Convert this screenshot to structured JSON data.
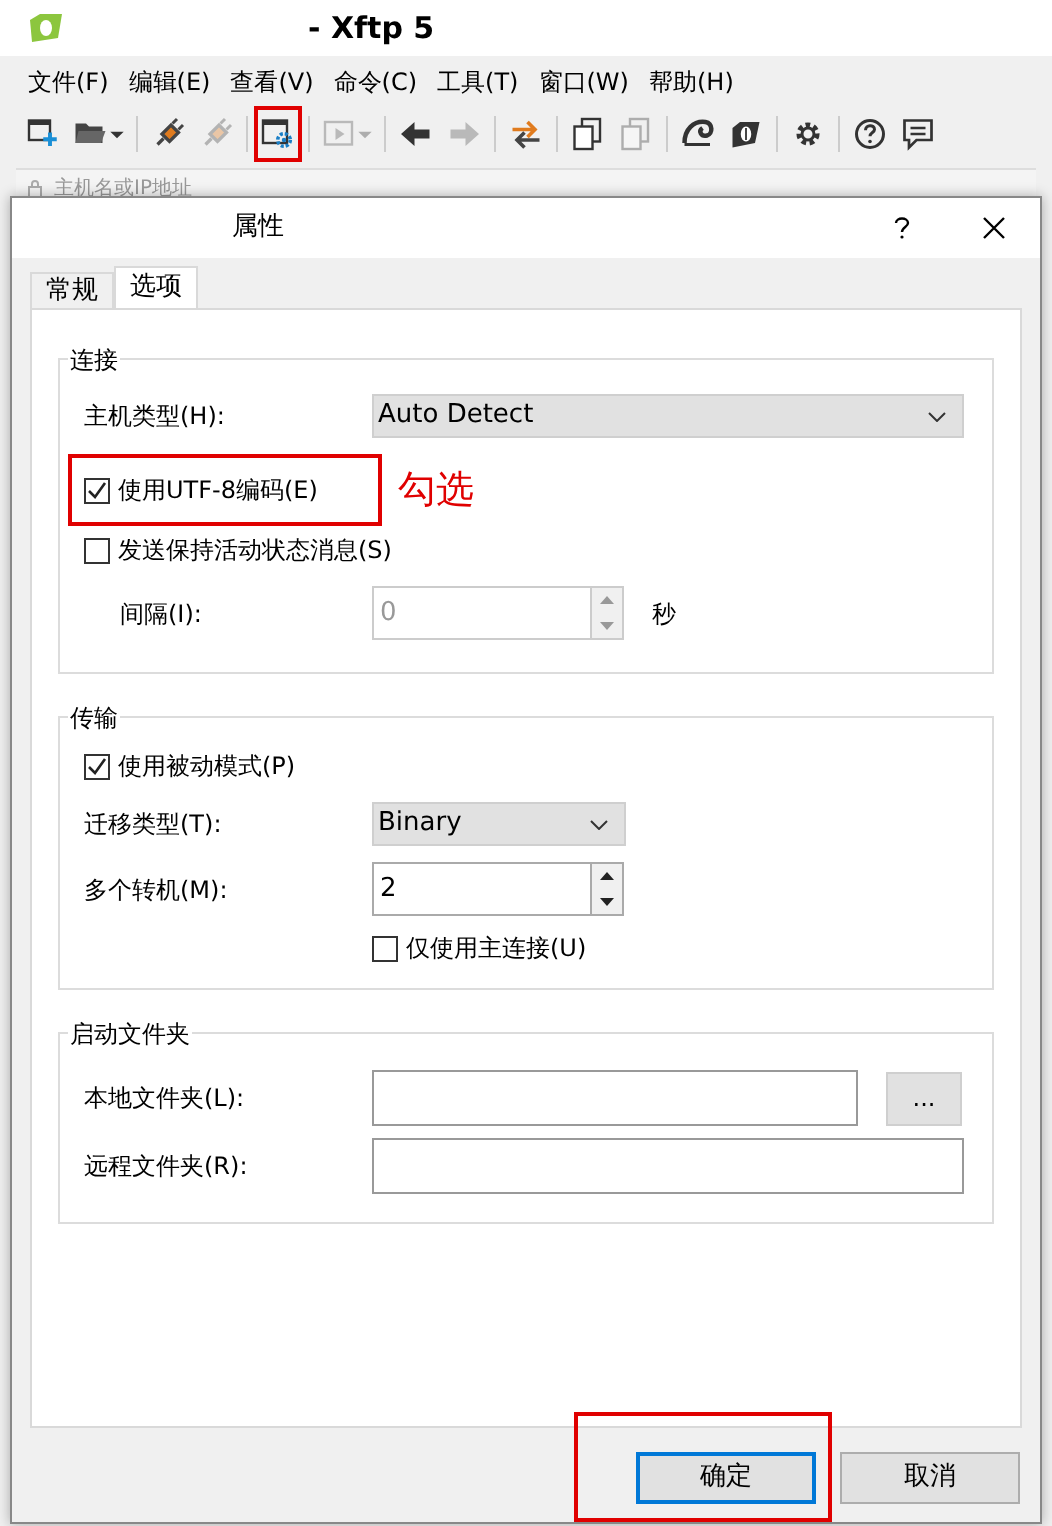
{
  "window": {
    "title": "- Xftp 5"
  },
  "menu": [
    "文件(F)",
    "编辑(E)",
    "查看(V)",
    "命令(C)",
    "工具(T)",
    "窗口(W)",
    "帮助(H)"
  ],
  "toolbar": [
    {
      "kind": "new",
      "disabled": false,
      "highlighted": false,
      "dropdown": false
    },
    {
      "kind": "folder",
      "disabled": false,
      "highlighted": false,
      "dropdown": true
    },
    {
      "kind": "sep"
    },
    {
      "kind": "connect",
      "disabled": false,
      "highlighted": false,
      "dropdown": false
    },
    {
      "kind": "connect",
      "disabled": true,
      "highlighted": false,
      "dropdown": false
    },
    {
      "kind": "sep"
    },
    {
      "kind": "properties",
      "disabled": false,
      "highlighted": true,
      "dropdown": false
    },
    {
      "kind": "sep"
    },
    {
      "kind": "play",
      "disabled": true,
      "highlighted": false,
      "dropdown": true
    },
    {
      "kind": "sep"
    },
    {
      "kind": "back",
      "disabled": false,
      "highlighted": false,
      "dropdown": false
    },
    {
      "kind": "forward",
      "disabled": true,
      "highlighted": false,
      "dropdown": false
    },
    {
      "kind": "sep"
    },
    {
      "kind": "transfer",
      "disabled": false,
      "highlighted": false,
      "dropdown": false
    },
    {
      "kind": "sep"
    },
    {
      "kind": "copy",
      "disabled": false,
      "highlighted": false,
      "dropdown": false
    },
    {
      "kind": "copy",
      "disabled": true,
      "highlighted": false,
      "dropdown": false
    },
    {
      "kind": "sep"
    },
    {
      "kind": "shell",
      "disabled": false,
      "highlighted": false,
      "dropdown": false
    },
    {
      "kind": "leaf",
      "disabled": false,
      "highlighted": false,
      "dropdown": false
    },
    {
      "kind": "sep"
    },
    {
      "kind": "gear",
      "disabled": false,
      "highlighted": false,
      "dropdown": false
    },
    {
      "kind": "sep"
    },
    {
      "kind": "help",
      "disabled": false,
      "highlighted": false,
      "dropdown": false
    },
    {
      "kind": "chat",
      "disabled": false,
      "highlighted": false,
      "dropdown": false
    }
  ],
  "address": {
    "placeholder": "主机名或IP地址"
  },
  "dialog": {
    "title": "属性",
    "tabs": [
      {
        "label": "常规",
        "selected": false
      },
      {
        "label": "选项",
        "selected": true
      }
    ],
    "groups": [
      {
        "title": "连接",
        "rows": [
          {
            "kind": "select",
            "label": "主机类型(H):",
            "value": "Auto Detect",
            "wide": true
          },
          {
            "kind": "checkbox",
            "label": "使用UTF-8编码(E)",
            "checked": true,
            "highlighted": true,
            "note": "勾选"
          },
          {
            "kind": "checkbox",
            "label": "发送保持活动状态消息(S)",
            "checked": false,
            "highlighted": false
          },
          {
            "kind": "spinner",
            "label": "间隔(I):",
            "value": "0",
            "disabled": true,
            "unit": "秒"
          }
        ]
      },
      {
        "title": "传输",
        "rows": [
          {
            "kind": "checkbox",
            "label": "使用被动模式(P)",
            "checked": true,
            "highlighted": false
          },
          {
            "kind": "select",
            "label": "迁移类型(T):",
            "value": "Binary",
            "wide": false
          },
          {
            "kind": "spinner",
            "label": "多个转机(M):",
            "value": "2",
            "disabled": false
          },
          {
            "kind": "subcheckbox",
            "label": "仅使用主连接(U)",
            "checked": false
          }
        ]
      },
      {
        "title": "启动文件夹",
        "rows": [
          {
            "kind": "text",
            "label": "本地文件夹(L):",
            "browse": "..."
          },
          {
            "kind": "text",
            "label": "远程文件夹(R):"
          }
        ]
      }
    ],
    "buttons": [
      {
        "label": "确定",
        "default": true,
        "highlighted": true
      },
      {
        "label": "取消",
        "default": false,
        "highlighted": false
      }
    ]
  }
}
